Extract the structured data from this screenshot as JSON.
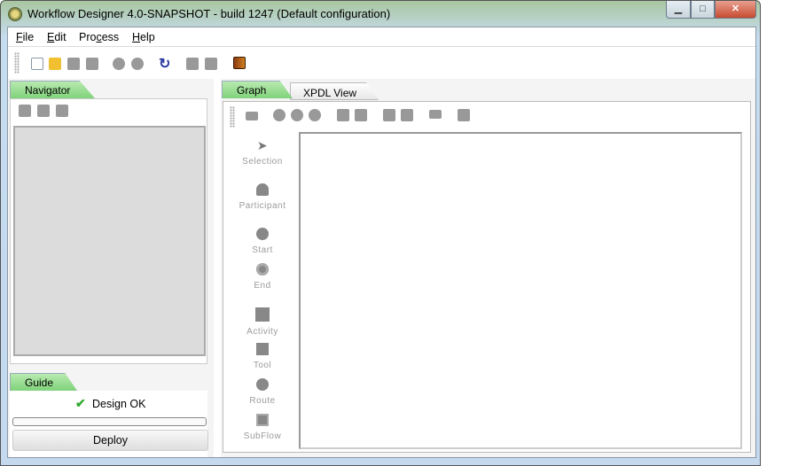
{
  "window": {
    "title": "Workflow Designer 4.0-SNAPSHOT - build 1247 (Default configuration)"
  },
  "menu": [
    {
      "label": "File",
      "mn": "F",
      "rest": "ile"
    },
    {
      "label": "Edit",
      "mn": "E",
      "rest": "dit"
    },
    {
      "label": "Process",
      "pre": "Pro",
      "mn": "c",
      "rest": "ess"
    },
    {
      "label": "Help",
      "mn": "H",
      "rest": "elp"
    }
  ],
  "navigator": {
    "tab": "Navigator"
  },
  "guide": {
    "tab": "Guide",
    "status": "Design OK",
    "deploy": "Deploy"
  },
  "tabs": [
    "Graph",
    "XPDL View"
  ],
  "palette": [
    "Selection",
    "Participant",
    "Start",
    "End",
    "Activity",
    "Tool",
    "Route",
    "SubFlow"
  ]
}
